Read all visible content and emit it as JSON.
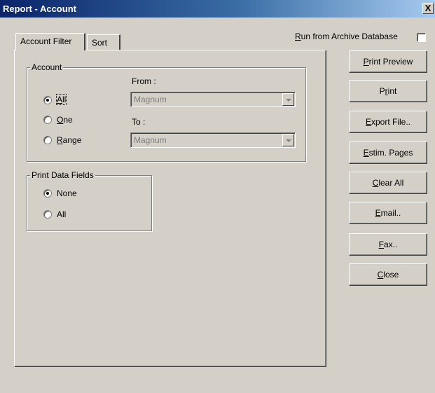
{
  "window": {
    "title": "Report - Account",
    "close_symbol": "X"
  },
  "tabs": [
    {
      "label": "Account Filter",
      "active": true
    },
    {
      "label": "Sort",
      "active": false
    }
  ],
  "archive": {
    "mnemonic": "R",
    "rest": "un from Archive Database",
    "checked": false
  },
  "account_group": {
    "legend": "Account",
    "options": [
      {
        "mnemonic": "A",
        "rest": "ll",
        "checked": true
      },
      {
        "mnemonic": "O",
        "rest": "ne",
        "checked": false
      },
      {
        "mnemonic": "R",
        "rest": "ange",
        "checked": false
      }
    ],
    "from_label": "From :",
    "from_value": "Magnum",
    "to_label": "To :",
    "to_value": "Magnum"
  },
  "print_fields_group": {
    "legend": "Print Data Fields",
    "options": [
      {
        "label": "None",
        "checked": true
      },
      {
        "label": "All",
        "checked": false
      }
    ]
  },
  "buttons": [
    {
      "pre": "",
      "mnemonic": "P",
      "rest": "rint Preview"
    },
    {
      "pre": "P",
      "mnemonic": "r",
      "rest": "int"
    },
    {
      "pre": "",
      "mnemonic": "E",
      "rest": "xport File.."
    },
    {
      "pre": "",
      "mnemonic": "E",
      "rest": "stim. Pages"
    },
    {
      "pre": "",
      "mnemonic": "C",
      "rest": "lear All"
    },
    {
      "pre": "",
      "mnemonic": "E",
      "rest": "mail.."
    },
    {
      "pre": "",
      "mnemonic": "F",
      "rest": "ax.."
    },
    {
      "pre": "",
      "mnemonic": "C",
      "rest": "lose"
    }
  ]
}
